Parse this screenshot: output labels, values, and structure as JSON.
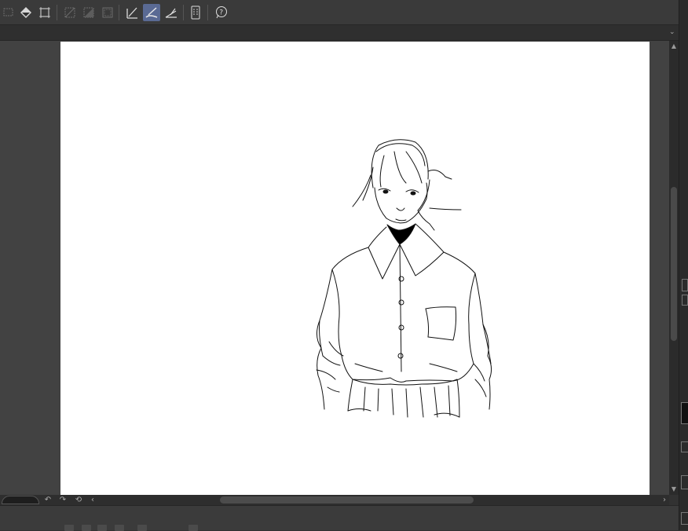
{
  "window": {
    "title": ""
  },
  "toolbar": {
    "buttons": [
      {
        "name": "selection-tool-button",
        "icon": "selection-icon",
        "state": "dim"
      },
      {
        "name": "fill-tool-button",
        "icon": "fill-bucket-icon",
        "state": "normal"
      },
      {
        "name": "transform-button",
        "icon": "transform-icon",
        "state": "normal"
      },
      {
        "name": "clear-selection-button",
        "icon": "clear-selection-icon",
        "state": "dim"
      },
      {
        "name": "invert-selection-button",
        "icon": "invert-selection-icon",
        "state": "dim"
      },
      {
        "name": "selection-border-button",
        "icon": "selection-border-icon",
        "state": "dim"
      },
      {
        "name": "ruler-pen-button",
        "icon": "ruler-pen-icon",
        "state": "normal"
      },
      {
        "name": "stabilizer-brush-button",
        "icon": "brush-stroke-icon",
        "state": "active"
      },
      {
        "name": "perspective-ruler-button",
        "icon": "perspective-ruler-icon",
        "state": "normal"
      },
      {
        "name": "device-button",
        "icon": "tablet-icon",
        "state": "normal"
      },
      {
        "name": "help-button",
        "icon": "help-icon",
        "state": "normal"
      }
    ]
  },
  "colors": {
    "accent_active": "#5a6a94",
    "canvas_bg": "#424242",
    "paper": "#ffffff",
    "ui_dark": "#323232",
    "line_art": "#111111"
  },
  "canvas": {
    "artwork": "line-art sketch of a girl in a buttoned shirt"
  },
  "bottombar": {
    "icons": [
      "rotate-left-icon",
      "rotate-right-icon",
      "reset-rotation-icon",
      "scroll-left-icon",
      "scroll-right-icon"
    ]
  }
}
